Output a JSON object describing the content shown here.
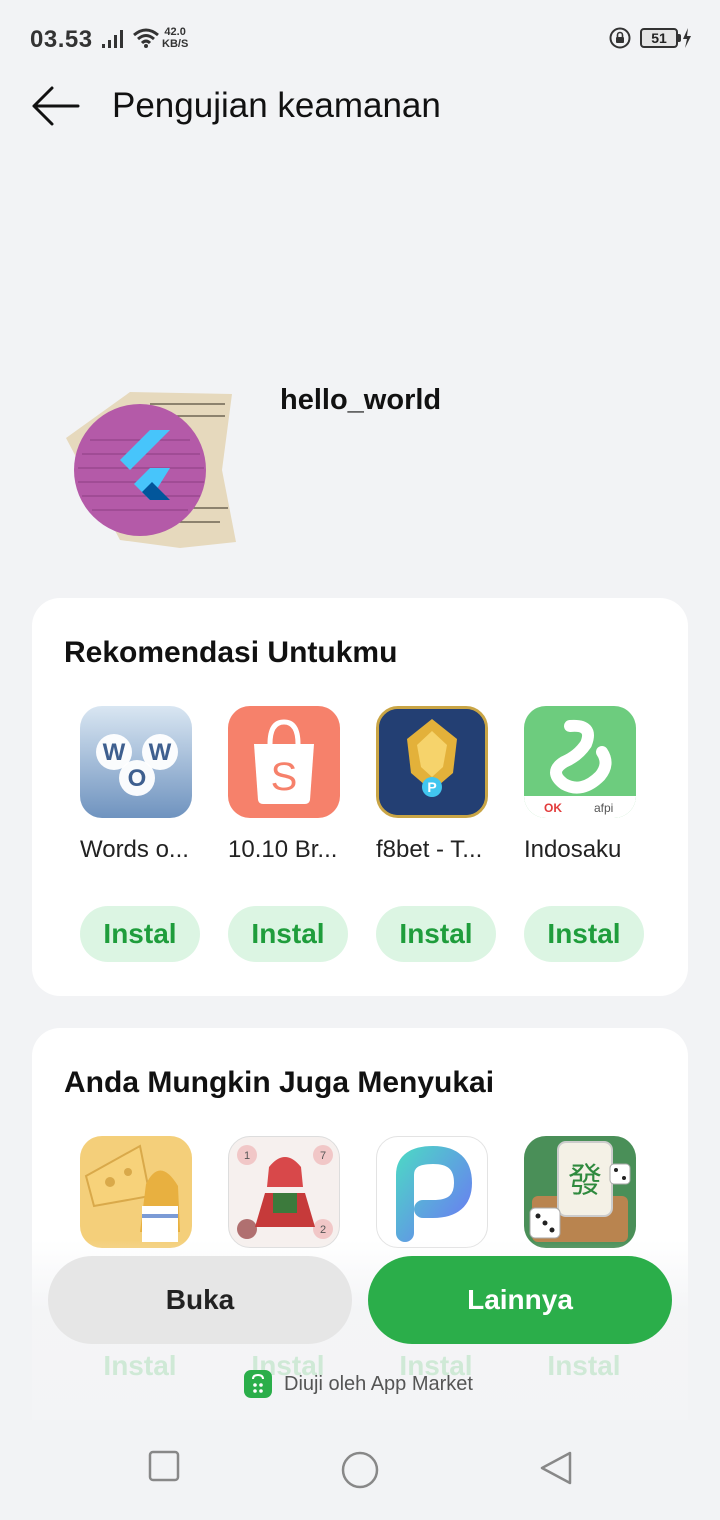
{
  "status_bar": {
    "time": "03.53",
    "net_speed_value": "42.0",
    "net_speed_unit": "KB/S",
    "battery": "51"
  },
  "header": {
    "title": "Pengujian keamanan"
  },
  "app": {
    "name": "hello_world"
  },
  "recommend": {
    "title": "Rekomendasi Untukmu",
    "apps": [
      {
        "label": "Words o...",
        "button": "Instal"
      },
      {
        "label": "10.10 Br...",
        "button": "Instal"
      },
      {
        "label": "f8bet - T...",
        "button": "Instal"
      },
      {
        "label": "Indosaku",
        "button": "Instal"
      }
    ]
  },
  "like": {
    "title": "Anda Mungkin Juga Menyukai",
    "apps": [
      {
        "button": "Instal"
      },
      {
        "button": "Instal"
      },
      {
        "button": "Instal"
      },
      {
        "button": "Instal"
      }
    ]
  },
  "actions": {
    "open_label": "Buka",
    "more_label": "Lainnya"
  },
  "footer": {
    "tested_by": "Diuji oleh App Market"
  },
  "colors": {
    "accent": "#2bae4a",
    "install_bg": "#dcf5e3",
    "install_text": "#1f9d3c",
    "background": "#f2f3f5"
  }
}
